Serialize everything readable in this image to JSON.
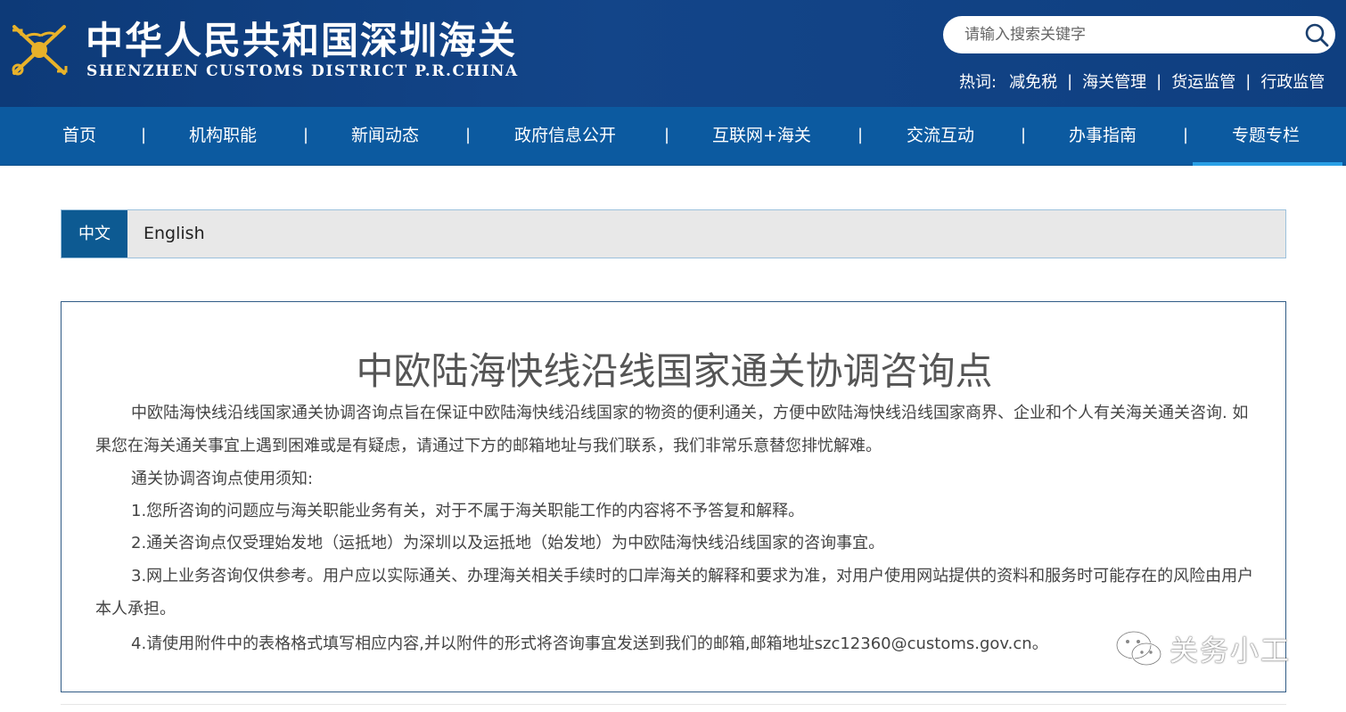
{
  "header": {
    "title_cn": "中华人民共和国深圳海关",
    "title_en": "SHENZHEN CUSTOMS DISTRICT P.R.CHINA",
    "emblem_icon": "customs-emblem-icon",
    "search": {
      "placeholder": "请输入搜索关键字",
      "value": "",
      "button_icon": "search-icon"
    },
    "hotwords": {
      "label": "热词:",
      "items": [
        "减免税",
        "海关管理",
        "货运监管",
        "行政监管"
      ],
      "separator": "|"
    }
  },
  "nav": {
    "items": [
      {
        "label": "首页"
      },
      {
        "label": "机构职能"
      },
      {
        "label": "新闻动态"
      },
      {
        "label": "政府信息公开"
      },
      {
        "label": "互联网+海关"
      },
      {
        "label": "交流互动"
      },
      {
        "label": "办事指南"
      },
      {
        "label": "专题专栏"
      }
    ],
    "separator": "|",
    "active": "专题专栏"
  },
  "lang_tabs": {
    "zh": "中文",
    "en": "English",
    "active": "中文"
  },
  "content": {
    "title": "中欧陆海快线沿线国家通关协调咨询点",
    "intro": "中欧陆海快线沿线国家通关协调咨询点旨在保证中欧陆海快线沿线国家的物资的便利通关，方便中欧陆海快线沿线国家商界、企业和个人有关海关通关咨询. 如果您在海关通关事宜上遇到困难或是有疑虑，请通过下方的邮箱地址与我们联系，我们非常乐意替您排忧解难。",
    "notice_heading": "通关协调咨询点使用须知:",
    "rules": [
      "1.您所咨询的问题应与海关职能业务有关，对于不属于海关职能工作的内容将不予答复和解释。",
      "2.通关咨询点仅受理始发地（运抵地）为深圳以及运抵地（始发地）为中欧陆海快线沿线国家的咨询事宜。",
      "3.网上业务咨询仅供参考。用户应以实际通关、办理海关相关手续时的口岸海关的解释和要求为准，对用户使用网站提供的资料和服务时可能存在的风险由用户本人承担。",
      "4.请使用附件中的表格格式填写相应内容,并以附件的形式将咨询事宜发送到我们的邮箱,邮箱地址szc12360@customs.gov.cn。"
    ]
  },
  "watermark": {
    "text": "关务小工",
    "icon": "wechat-icon"
  },
  "colors": {
    "header_bg": "#134589",
    "nav_bg": "#0c5aa0",
    "active_underline": "#2aa0e6",
    "lang_active_bg": "#0d5a92",
    "content_border": "#315c86"
  }
}
